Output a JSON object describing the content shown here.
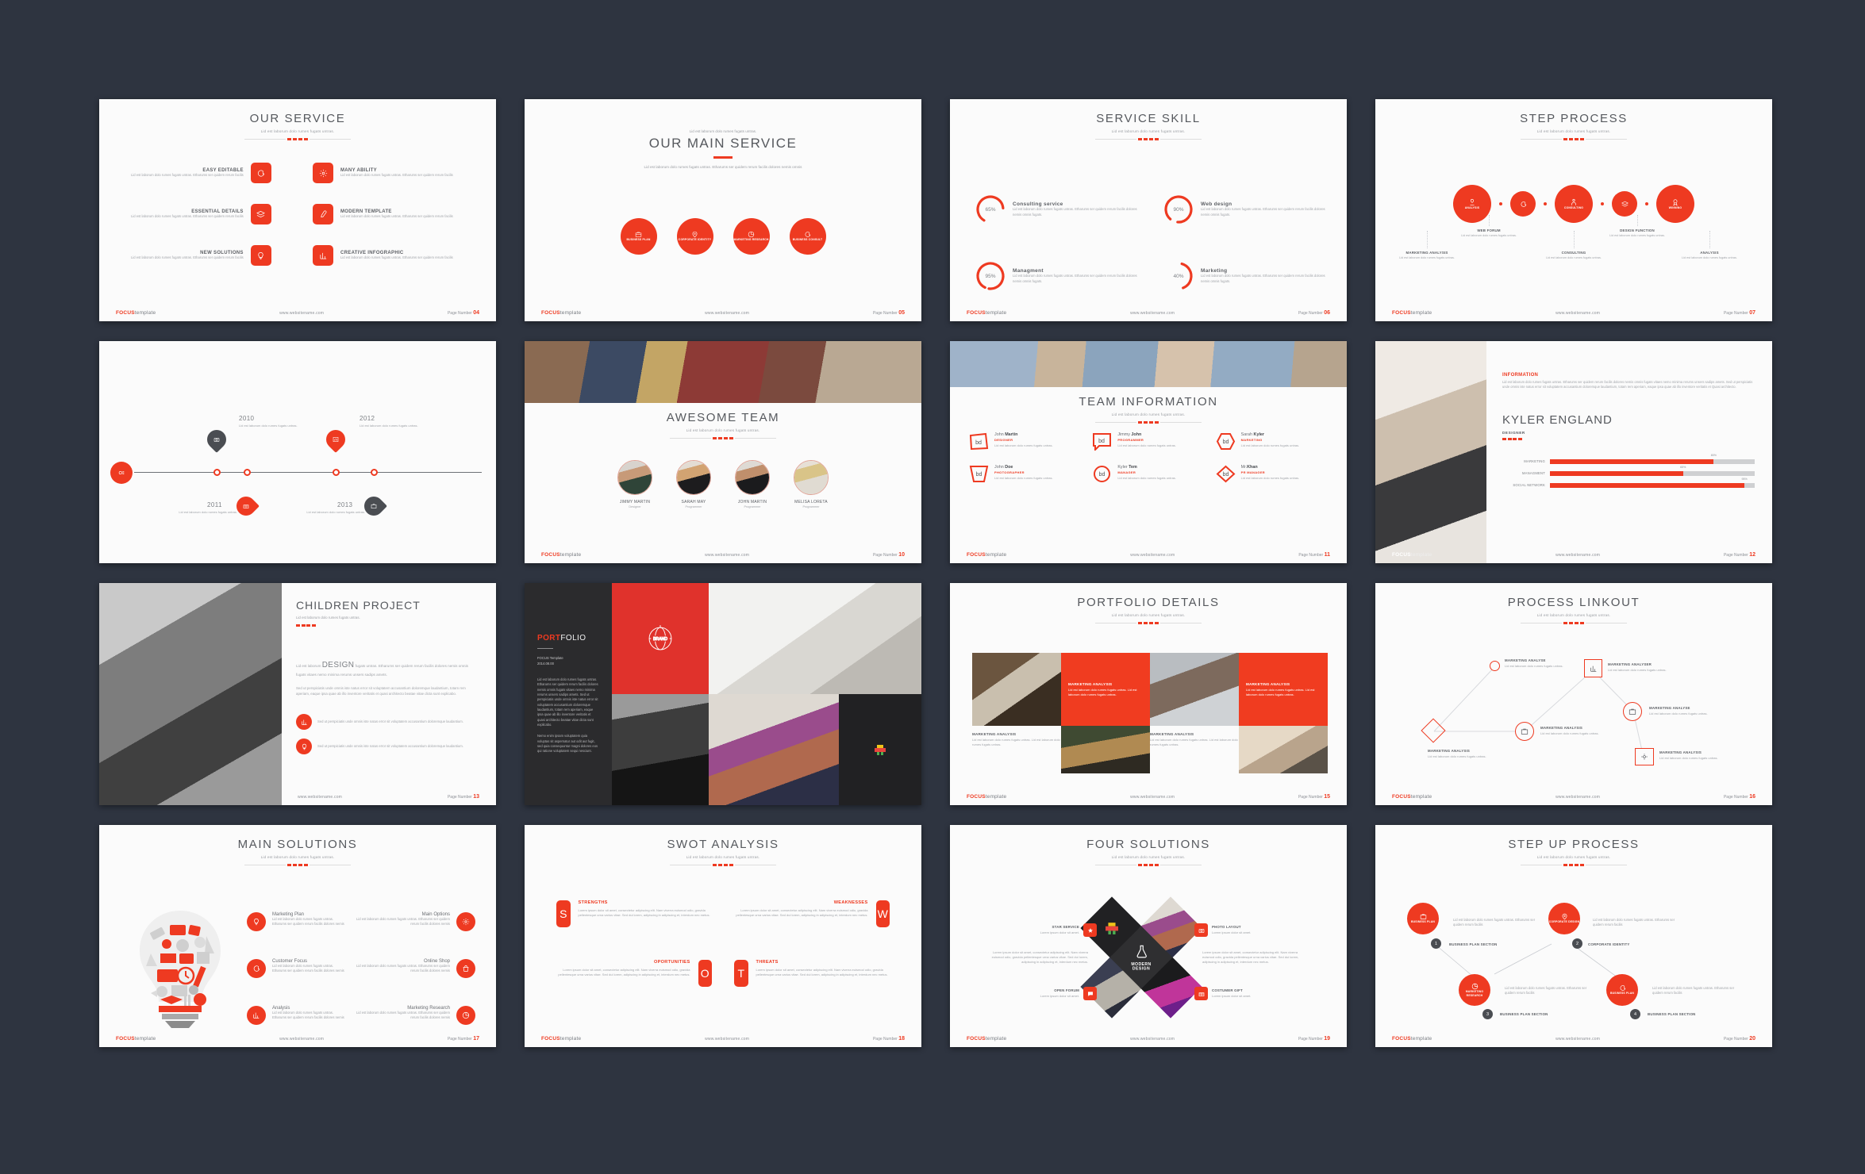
{
  "common": {
    "brand": "FOCUS",
    "brand_suffix": "template",
    "site": "www.websitename.com",
    "page_label": "Page Number",
    "lorem_short": "Lid est laborum dolo rumes fugats untras.",
    "lorem_med": "Lid est laborum dolo rumes fugats untras. Etharums ser quidem rerum facilis.",
    "lorem_long": "Lid est laborum dolo rumes fugats untras. Etharums ser quidem rerum facilis dolores nemis omnis fugats.",
    "accent": "#ee3a21",
    "dark": "#2e3440",
    "text_dark": "#56595e",
    "text_muted": "#a2a5aa"
  },
  "slides": [
    {
      "id": "our-service",
      "title": "OUR SERVICE",
      "subtitle": "Lid est laborum dolo rumes fugats untras.",
      "page": "04",
      "items": [
        {
          "title": "EASY EDITABLE",
          "icon": "chat-icon",
          "desc": "Lid est laborum dolo rumes fugats untras. Etharums ser quidem rerum facilis"
        },
        {
          "title": "MANY ABILITY",
          "icon": "gear-icon",
          "desc": "Lid est laborum dolo rumes fugats untras. Etharums ser quidem rerum facilis"
        },
        {
          "title": "ESSENTIAL DETAILS",
          "icon": "layers-icon",
          "desc": "Lid est laborum dolo rumes fugats untras. Etharums ser quidem rerum facilis"
        },
        {
          "title": "MODERN TEMPLATE",
          "icon": "pen-icon",
          "desc": "Lid est laborum dolo rumes fugats untras. Etharums ser quidem rerum facilis"
        },
        {
          "title": "NEW SOLUTIONS",
          "icon": "bulb-icon",
          "desc": "Lid est laborum dolo rumes fugats untras. Etharums ser quidem rerum facilis"
        },
        {
          "title": "CREATIVE INFOGRAPHIC",
          "icon": "bar-chart-icon",
          "desc": "Lid est laborum dolo rumes fugats untras. Etharums ser quidem rerum facilis"
        }
      ]
    },
    {
      "id": "our-main-service",
      "eyebrow": "Lid est laborum dolo rumes fugats untras.",
      "title": "OUR MAIN SERVICE",
      "subtitle": "Lid est laborum dolo rumes fugats untras. Etharums ser quidem rerum facilis dolores nemis omnis",
      "page": "05",
      "circles": [
        {
          "label": "BUSINESS PLAN",
          "icon": "briefcase-icon"
        },
        {
          "label": "CORPORATE IDENTITY",
          "icon": "pin-icon"
        },
        {
          "label": "MARKETING RESEARCH",
          "icon": "pie-icon"
        },
        {
          "label": "BUSINESS CONSULT",
          "icon": "chat-icon"
        }
      ]
    },
    {
      "id": "service-skill",
      "title": "SERVICE SKILL",
      "subtitle": "Lid est laborum dolo rumes fugats untras.",
      "page": "06",
      "skills": [
        {
          "name": "Consulting service",
          "percent": 65,
          "desc": "Lid est laborum dolo rumes fugats untras. Etharums ser quidem rerum facilis dolores nemis omnis fugats."
        },
        {
          "name": "Web design",
          "percent": 90,
          "desc": "Lid est laborum dolo rumes fugats untras. Etharums ser quidem rerum facilis dolores nemis omnis fugats."
        },
        {
          "name": "Managment",
          "percent": 95,
          "desc": "Lid est laborum dolo rumes fugats untras. Etharums ser quidem rerum facilis dolores nemis omnis fugats."
        },
        {
          "name": "Marketing",
          "percent": 40,
          "desc": "Lid est laborum dolo rumes fugats untras. Etharums ser quidem rerum facilis dolores nemis omnis fugats."
        }
      ]
    },
    {
      "id": "step-process",
      "title": "STEP PROCESS",
      "subtitle": "Lid est laborum dolo rumes fugats untras.",
      "page": "07",
      "steps": [
        {
          "circle": "ANALYSIS",
          "icon": "analysis-icon",
          "caption": "MARKETING ANALYSIS",
          "desc": "Lid est laborum dolo rumes fugats untras."
        },
        {
          "circle": "",
          "icon": "chat-icon",
          "caption": "WEB FORUM",
          "desc": "Lid est laborum dolo rumes fugats untras."
        },
        {
          "circle": "CONSULTING",
          "icon": "consult-icon",
          "caption": "CONSULTING",
          "desc": "Lid est laborum dolo rumes fugats untras."
        },
        {
          "circle": "",
          "icon": "layers-icon",
          "caption": "DESIGN FUNCTION",
          "desc": "Lid est laborum dolo rumes fugats untras."
        },
        {
          "circle": "WINNING",
          "icon": "medal-icon",
          "caption": "ANALYSIS",
          "desc": "Lid est laborum dolo rumes fugats untras."
        }
      ]
    },
    {
      "id": "timeline",
      "page": "",
      "events": [
        {
          "year": "2010",
          "icon": "camera-icon",
          "desc": "Lid est laborum dolo rumes fugats untras.",
          "position": "top",
          "color": "dark"
        },
        {
          "year": "2011",
          "icon": "gift-icon",
          "desc": "Lid est laborum dolo rumes fugats untras.",
          "position": "bottom",
          "color": "red"
        },
        {
          "year": "2012",
          "icon": "chart-icon",
          "desc": "Lid est laborum dolo rumes fugats untras.",
          "position": "top",
          "color": "red"
        },
        {
          "year": "2013",
          "icon": "briefcase-icon",
          "desc": "Lid est laborum dolo rumes fugats untras.",
          "position": "bottom",
          "color": "dark"
        }
      ]
    },
    {
      "id": "awesome-team",
      "title": "AWESOME TEAM",
      "subtitle": "Lid est laborum dolo rumes fugats untras.",
      "page": "10",
      "members": [
        {
          "name": "JIMMY MARTIN",
          "role": "Designer"
        },
        {
          "name": "SARAH MAY",
          "role": "Programmer"
        },
        {
          "name": "JOHN MARTIN",
          "role": "Programmer"
        },
        {
          "name": "MELISA LORETA",
          "role": "Programmer"
        }
      ]
    },
    {
      "id": "team-information",
      "title": "TEAM INFORMATION",
      "subtitle": "Lid est laborum dolo rumes fugats untras.",
      "page": "11",
      "members": [
        {
          "first": "John ",
          "last": "Martin",
          "role": "DESIGNER",
          "shape": "pentagon",
          "desc": "Lid est laborum dolo rumes fugats untras."
        },
        {
          "first": "Jimmy ",
          "last": "John",
          "role": "PROGRAMMER",
          "shape": "speech",
          "desc": "Lid est laborum dolo rumes fugats untras."
        },
        {
          "first": "Sarah ",
          "last": "Kyler",
          "role": "MARKETING",
          "shape": "hexagon",
          "desc": "Lid est laborum dolo rumes fugats untras."
        },
        {
          "first": "John ",
          "last": "Doe",
          "role": "PHOTOGRAPHER",
          "shape": "trapezoid",
          "desc": "Lid est laborum dolo rumes fugats untras."
        },
        {
          "first": "Kyler ",
          "last": "Tem",
          "role": "MANAGER",
          "shape": "circle",
          "desc": "Lid est laborum dolo rumes fugats untras."
        },
        {
          "first": "Mr.",
          "last": "Khan",
          "role": "PR MANAGER",
          "shape": "diamond",
          "desc": "Lid est laborum dolo rumes fugats untras."
        }
      ]
    },
    {
      "id": "kyler-england",
      "info_heading": "INFORMATION",
      "info_text": "Lid est laborum dolo rumes fugats untras. Etharums ser quidem rerum facilis dolores nemis omnis fugats vitaes nemo minima rerums unsers sadips amets. Sed ut perspiciatis unde omnis iste natus error sit voluptatem accusantium doloremque laudantium, totam rem aperiam, eaque ipsa quae ab illo inventore veritatis et Quasi architecto.",
      "name": "KYLER ENGLAND",
      "role": "DESIGNER",
      "page": "12",
      "bars": [
        {
          "label": "MARKETING",
          "percent": 80
        },
        {
          "label": "MANAGMENT",
          "percent": 65
        },
        {
          "label": "SOCIAL NETWORK",
          "percent": 95
        }
      ]
    },
    {
      "id": "children-project",
      "title": "CHILDREN PROJECT",
      "subtitle": "Lid est laborum dolo rumes fugats untras.",
      "page": "13",
      "highlight": "DESIGN",
      "para_lead_before": "Lid est laborum ",
      "para_lead_after": " fugats untras. Etharums ser quidem rerum facilis dolores nemis omnis fugats vitaes nemo minima rerums unsers sadips amets.",
      "para_body": "Sed ut perspiciatis unde omnis iste natus error sit voluptatem accusantium doloremque laudantium, totam rem aperiam, eaque ipsa quae ab illo inventore veritatis et quasi architecto beatae vitae dicta sunt explicabo.",
      "bullets": [
        {
          "icon": "bar-chart-icon",
          "text": "Sed ut perspiciatis unde omnis iste natus error sit voluptatem accusantium doloremque laudantium."
        },
        {
          "icon": "bulb-icon",
          "text": "Sed ut perspiciatis unde omnis iste natus error sit voluptatem accusantium doloremque laudantium."
        }
      ]
    },
    {
      "id": "portfolio",
      "title_a": "PORT",
      "title_b": "FOLIO",
      "meta_line1": "FOCUS Template",
      "meta_line2": "2014.08.00",
      "para1": "Lid est laborum dolo rumes fugats untras. Etharums ser quidem rerum facilis dolores nemis omnis fugats vitaes nemo minima rerums unsers sadips amets. Sed ut perspiciatis unde omnis iste natus error sit voluptatem accusantium doloremque laudantium, totam rem aperiam, eaque ipsa quae ab illo inventore veritatis et quasi architecto beatae vitae dicta sunt explicabo.",
      "para2": "Nemo enim ipsam voluptatem quia voluptas sit aspernatur aut odit aut fugit, sed quia consequuntur magni dolores eos qui ratione voluptatem sequi nesciunt."
    },
    {
      "id": "portfolio-details",
      "title": "PORTFOLIO DETAILS",
      "subtitle": "Lid est laborum dolo rumes fugats untras.",
      "page": "15",
      "cards": [
        {
          "title": "MARKETING ANALYSIS",
          "desc": "Lid est laborum dolo rumes fugats untras. Lid est laborum dolo rumes fugats untras.",
          "style": "red"
        },
        {
          "title": "MARKETING ANALYSIS",
          "desc": "Lid est laborum dolo rumes fugats untras. Lid est laborum dolo rumes fugats untras.",
          "style": "red"
        },
        {
          "title": "MARKETING ANALYSIS",
          "desc": "Lid est laborum dolo rumes fugats untras. Lid est laborum dolo rumes fugats untras.",
          "style": "plain"
        },
        {
          "title": "MARKETING ANALYSIS",
          "desc": "Lid est laborum dolo rumes fugats untras. Lid est laborum dolo rumes fugats untras.",
          "style": "plain"
        }
      ]
    },
    {
      "id": "process-linkout",
      "title": "PROCESS LINKOUT",
      "subtitle": "Lid est laborum dolo rumes fugats untras.",
      "page": "16",
      "nodes": [
        {
          "label": "MARKETING ANALYSE",
          "desc": "Lid est laborum dolo rumes fugats untras.",
          "shape": "circle-small",
          "icon": ""
        },
        {
          "label": "MARKETING ANALYSER",
          "desc": "Lid est laborum dolo rumes fugats untras.",
          "shape": "square",
          "icon": "bar-chart-icon"
        },
        {
          "label": "MARKETING ANALYSE",
          "desc": "Lid est laborum dolo rumes fugats untras.",
          "shape": "circle",
          "icon": "briefcase-icon"
        },
        {
          "label": "MARKETING ANALYSIS",
          "desc": "Lid est laborum dolo rumes fugats untras.",
          "shape": "circle",
          "icon": "briefcase-icon"
        },
        {
          "label": "MARKETING ANALYSIS",
          "desc": "Lid est laborum dolo rumes fugats untras.",
          "shape": "diamond",
          "icon": ""
        },
        {
          "label": "MARKETING ANALYSIS",
          "desc": "Lid est laborum dolo rumes fugats untras.",
          "shape": "pentagon",
          "icon": "gear-icon"
        }
      ]
    },
    {
      "id": "main-solutions",
      "title": "MAIN SOLUTIONS",
      "subtitle": "Lid est laborum dolo rumes fugats untras.",
      "page": "17",
      "left": [
        {
          "title": "Marketing Plan",
          "icon": "bulb-icon",
          "desc": "Lid est laborum dolo rumes fugats untras. Etharums ser quidem rerum facilis dolores nemis"
        },
        {
          "title": "Customer Focus",
          "icon": "chat-icon",
          "desc": "Lid est laborum dolo rumes fugats untras. Etharums ser quidem rerum facilis dolores nemis"
        },
        {
          "title": "Analysis",
          "icon": "bar-chart-icon",
          "desc": "Lid est laborum dolo rumes fugats untras. Etharums ser quidem rerum facilis dolores nemis"
        }
      ],
      "right": [
        {
          "title": "Main Options",
          "icon": "gear-icon",
          "desc": "Lid est laborum dolo rumes fugats untras. Etharums ser quidem rerum facilis dolores nemis"
        },
        {
          "title": "Online Shop",
          "icon": "bag-icon",
          "desc": "Lid est laborum dolo rumes fugats untras. Etharums ser quidem rerum facilis dolores nemis"
        },
        {
          "title": "Marketing Research",
          "icon": "pie-icon",
          "desc": "Lid est laborum dolo rumes fugats untras. Etharums ser quidem rerum facilis dolores nemis"
        }
      ]
    },
    {
      "id": "swot-analysis",
      "title": "SWOT ANALYSIS",
      "subtitle": "Lid est laborum dolo rumes fugats untras.",
      "page": "18",
      "quadrants": [
        {
          "letter": "S",
          "heading": "STRENGTHS",
          "desc": "Lorem ipsum dolor sit amet, consectetur adipiscing elit. Nam viverra euismod odio, gravida pellentesque urna varius vitae. Sed dui lorem, adipiscing in adipiscing et, interdum nec metus."
        },
        {
          "letter": "W",
          "heading": "WEAKNESSES",
          "desc": "Lorem ipsum dolor sit amet, consectetur adipiscing elit. Nam viverra euismod odio, gravida pellentesque urna varius vitae. Sed dui lorem, adipiscing in adipiscing et, interdum nec metus."
        },
        {
          "letter": "O",
          "heading": "OPORTUNITIES",
          "desc": "Lorem ipsum dolor sit amet, consectetur adipiscing elit. Nam viverra euismod odio, gravida pellentesque urna varius vitae. Sed dui lorem, adipiscing in adipiscing et, interdum nec metus."
        },
        {
          "letter": "T",
          "heading": "THREATS",
          "desc": "Lorem ipsum dolor sit amet, consectetur adipiscing elit. Nam viverra euismod odio, gravida pellentesque urna varius vitae. Sed dui lorem, adipiscing in adipiscing et, interdum nec metus."
        }
      ]
    },
    {
      "id": "four-solutions",
      "title": "FOUR SOLUTIONS",
      "subtitle": "Lid est laborum dolo rumes fugats untras.",
      "page": "19",
      "center_label_line1": "MODERN",
      "center_label_line2": "DESIGN",
      "items": [
        {
          "label": "STAR SERVICE",
          "sub": "Lorem ipsum dolor sit amet.",
          "icon": "star-icon"
        },
        {
          "label": "PHOTO LAYOUT",
          "sub": "Lorem ipsum dolor sit amet.",
          "icon": "camera-icon"
        },
        {
          "label": "OPEN FORUM",
          "sub": "Lorem ipsum dolor sit amet.",
          "icon": "chat-icon"
        },
        {
          "label": "COSTUMER GIFT",
          "sub": "Lorem ipsum dolor sit amet.",
          "icon": "gift-icon"
        }
      ],
      "para_left": "Lorem ipsum dolor sit amet, consectetur adipiscing elit. Nam viverra euismod odio, gravida pellentesque urna varius vitae. Sed dui lorem, adipiscing in adipiscing et, interdum nec metus.",
      "para_right": "Lorem ipsum dolor sit amet, consectetur adipiscing elit. Nam viverra euismod odio, gravida pellentesque urna varius vitae. Sed dui lorem, adipiscing in adipiscing et, interdum nec metus."
    },
    {
      "id": "step-up-process",
      "title": "STEP UP PROCESS",
      "subtitle": "Lid est laborum dolo rumes fugats untras.",
      "page": "20",
      "steps": [
        {
          "num": "1",
          "circle": "BUSINESS PLAN",
          "icon": "briefcase-icon",
          "section": "BUSINESS PLAN SECTION",
          "desc": "Lid est laborum dolo rumes fugats untras. Etharums ser quidem rerum facilis"
        },
        {
          "num": "2",
          "circle": "CORPORATE DESIGN",
          "icon": "pin-icon",
          "section": "CORPORATE IDENTITY",
          "desc": "Lid est laborum dolo rumes fugats untras. Etharums ser quidem rerum facilis"
        },
        {
          "num": "3",
          "circle": "MARKETING RESEARCH",
          "icon": "pie-icon",
          "section": "BUSINESS PLAN SECTION",
          "desc": "Lid est laborum dolo rumes fugats untras. Etharums ser quidem rerum facilis"
        },
        {
          "num": "4",
          "circle": "BUSINESS PLAN",
          "icon": "chat-icon",
          "section": "BUSINESS PLAN SECTION",
          "desc": "Lid est laborum dolo rumes fugats untras. Etharums ser quidem rerum facilis"
        }
      ]
    }
  ]
}
